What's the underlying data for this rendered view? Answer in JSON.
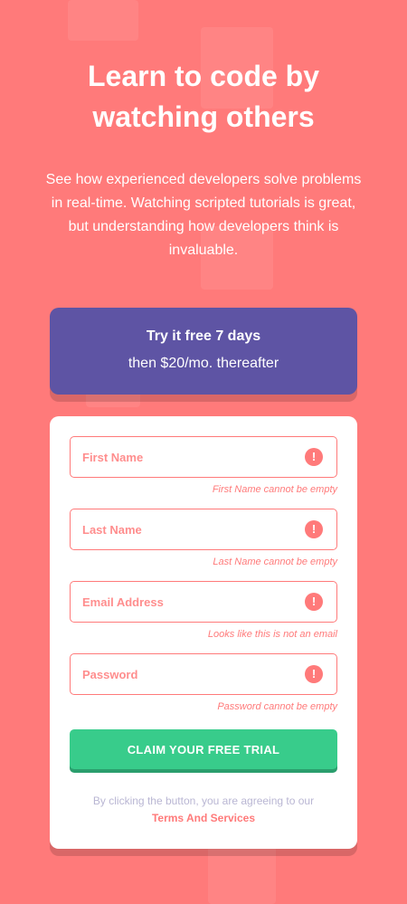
{
  "hero": {
    "title": "Learn to code by watching others",
    "description": "See how experienced developers solve problems in real-time. Watching scripted tutorials is great, but understanding how developers think is invaluable."
  },
  "promo": {
    "bold": "Try it free 7 days",
    "rest": "then $20/mo. thereafter"
  },
  "form": {
    "first_name": {
      "placeholder": "First Name",
      "value": "",
      "error": "First Name cannot be empty"
    },
    "last_name": {
      "placeholder": "Last Name",
      "value": "",
      "error": "Last Name cannot be empty"
    },
    "email": {
      "placeholder": "Email Address",
      "value": "",
      "error": "Looks like this is not an email"
    },
    "password": {
      "placeholder": "Password",
      "value": "",
      "error": "Password cannot be empty"
    },
    "error_icon": "!",
    "submit_label": "CLAIM YOUR FREE TRIAL",
    "terms_text": "By clicking the button, you are agreeing to our",
    "terms_link": "Terms And Services"
  },
  "colors": {
    "background": "#ff7a7a",
    "promo": "#5e54a4",
    "cta": "#38cc8b",
    "error": "#ff7a7a"
  },
  "icons": [
    "error-icon"
  ]
}
